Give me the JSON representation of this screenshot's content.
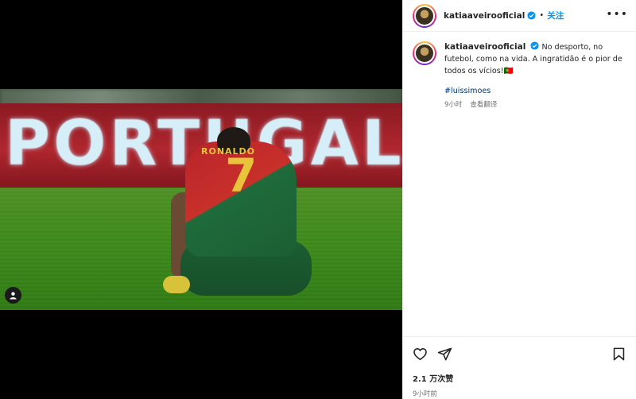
{
  "post": {
    "photo": {
      "board_text": "PORTUGAL",
      "shirt_name": "RONALDO",
      "shirt_number": "7"
    },
    "header": {
      "username": "katiaaveirooficial",
      "separator": "•",
      "follow_label": "关注",
      "more_label": "•••"
    },
    "caption": {
      "username": "katiaaveirooficial",
      "text": "No desporto, no futebol, como na vida. A ingratidão é o pior de todos os vícios!🇵🇹",
      "hashtag": "#luissimoes",
      "time": "9小时",
      "translate_label": "查看翻译"
    },
    "actions": {
      "icons": [
        "heart-icon",
        "share-icon",
        "bookmark-icon"
      ],
      "likes": "2.1 万次赞",
      "time": "9小时前"
    },
    "colors": {
      "follow": "#0095f6",
      "verified": "#0095f6",
      "hashtag": "#00376b",
      "muted": "#737373"
    }
  }
}
